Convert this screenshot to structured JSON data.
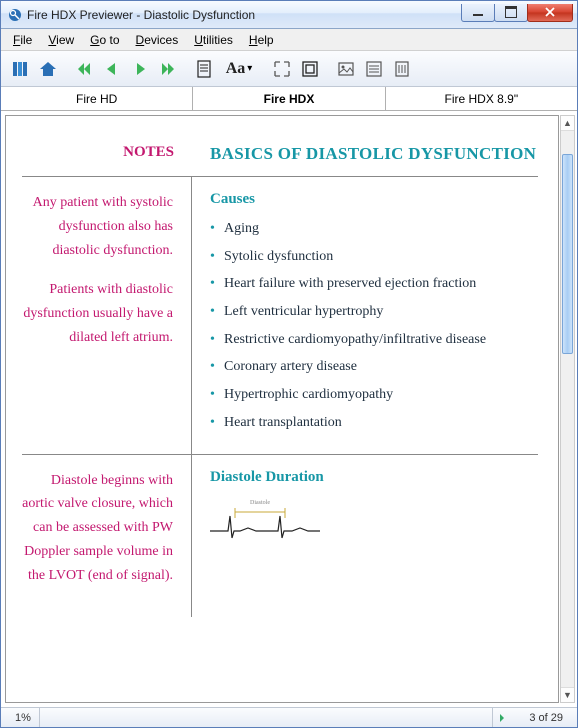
{
  "window": {
    "title": "Fire HDX Previewer - Diastolic Dysfunction"
  },
  "menu": {
    "file": "File",
    "view": "View",
    "goto": "Go to",
    "devices": "Devices",
    "utilities": "Utilities",
    "help": "Help"
  },
  "toolbar": {
    "aa_label": "Aa",
    "dropdown_glyph": "▾"
  },
  "device_tabs": {
    "hd": "Fire HD",
    "hdx": "Fire HDX",
    "hdx89": "Fire HDX 8.9\""
  },
  "doc": {
    "notes_heading": "NOTES",
    "main_heading": "BASICS OF DIASTOLIC DYSFUNCTION",
    "section1": {
      "note_a": "Any patient with systolic dysfunction also has diastolic dysfunction.",
      "note_b": "Patients with diastolic dysfunction usually have a dilated left atrium.",
      "heading": "Causes",
      "items": [
        "Aging",
        "Sytolic dysfunction",
        "Heart failure with preserved ejection fraction",
        "Left ventricular hypertrophy",
        "Restrictive cardiomyopathy/infiltrative disease",
        "Coronary artery disease",
        "Hypertrophic cardiomyopathy",
        "Heart transplantation"
      ]
    },
    "section2": {
      "note": "Diastole beginns with aortic valve closure, which can be assessed with PW Doppler sample volume in the LVOT (end of signal).",
      "heading": "Diastole Duration",
      "diagram_label": "Diastole"
    }
  },
  "status": {
    "zoom": "1%",
    "page": "3 of 29"
  }
}
